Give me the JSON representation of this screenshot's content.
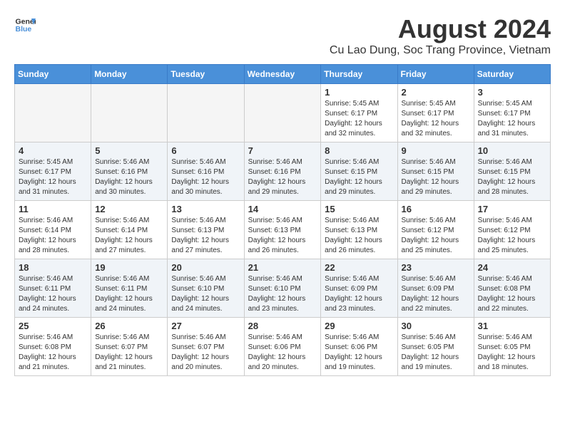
{
  "logo": {
    "line1": "General",
    "line2": "Blue"
  },
  "title": "August 2024",
  "subtitle": "Cu Lao Dung, Soc Trang Province, Vietnam",
  "days_of_week": [
    "Sunday",
    "Monday",
    "Tuesday",
    "Wednesday",
    "Thursday",
    "Friday",
    "Saturday"
  ],
  "weeks": [
    [
      {
        "day": "",
        "details": ""
      },
      {
        "day": "",
        "details": ""
      },
      {
        "day": "",
        "details": ""
      },
      {
        "day": "",
        "details": ""
      },
      {
        "day": "1",
        "details": "Sunrise: 5:45 AM\nSunset: 6:17 PM\nDaylight: 12 hours\nand 32 minutes."
      },
      {
        "day": "2",
        "details": "Sunrise: 5:45 AM\nSunset: 6:17 PM\nDaylight: 12 hours\nand 32 minutes."
      },
      {
        "day": "3",
        "details": "Sunrise: 5:45 AM\nSunset: 6:17 PM\nDaylight: 12 hours\nand 31 minutes."
      }
    ],
    [
      {
        "day": "4",
        "details": "Sunrise: 5:45 AM\nSunset: 6:17 PM\nDaylight: 12 hours\nand 31 minutes."
      },
      {
        "day": "5",
        "details": "Sunrise: 5:46 AM\nSunset: 6:16 PM\nDaylight: 12 hours\nand 30 minutes."
      },
      {
        "day": "6",
        "details": "Sunrise: 5:46 AM\nSunset: 6:16 PM\nDaylight: 12 hours\nand 30 minutes."
      },
      {
        "day": "7",
        "details": "Sunrise: 5:46 AM\nSunset: 6:16 PM\nDaylight: 12 hours\nand 29 minutes."
      },
      {
        "day": "8",
        "details": "Sunrise: 5:46 AM\nSunset: 6:15 PM\nDaylight: 12 hours\nand 29 minutes."
      },
      {
        "day": "9",
        "details": "Sunrise: 5:46 AM\nSunset: 6:15 PM\nDaylight: 12 hours\nand 29 minutes."
      },
      {
        "day": "10",
        "details": "Sunrise: 5:46 AM\nSunset: 6:15 PM\nDaylight: 12 hours\nand 28 minutes."
      }
    ],
    [
      {
        "day": "11",
        "details": "Sunrise: 5:46 AM\nSunset: 6:14 PM\nDaylight: 12 hours\nand 28 minutes."
      },
      {
        "day": "12",
        "details": "Sunrise: 5:46 AM\nSunset: 6:14 PM\nDaylight: 12 hours\nand 27 minutes."
      },
      {
        "day": "13",
        "details": "Sunrise: 5:46 AM\nSunset: 6:13 PM\nDaylight: 12 hours\nand 27 minutes."
      },
      {
        "day": "14",
        "details": "Sunrise: 5:46 AM\nSunset: 6:13 PM\nDaylight: 12 hours\nand 26 minutes."
      },
      {
        "day": "15",
        "details": "Sunrise: 5:46 AM\nSunset: 6:13 PM\nDaylight: 12 hours\nand 26 minutes."
      },
      {
        "day": "16",
        "details": "Sunrise: 5:46 AM\nSunset: 6:12 PM\nDaylight: 12 hours\nand 25 minutes."
      },
      {
        "day": "17",
        "details": "Sunrise: 5:46 AM\nSunset: 6:12 PM\nDaylight: 12 hours\nand 25 minutes."
      }
    ],
    [
      {
        "day": "18",
        "details": "Sunrise: 5:46 AM\nSunset: 6:11 PM\nDaylight: 12 hours\nand 24 minutes."
      },
      {
        "day": "19",
        "details": "Sunrise: 5:46 AM\nSunset: 6:11 PM\nDaylight: 12 hours\nand 24 minutes."
      },
      {
        "day": "20",
        "details": "Sunrise: 5:46 AM\nSunset: 6:10 PM\nDaylight: 12 hours\nand 24 minutes."
      },
      {
        "day": "21",
        "details": "Sunrise: 5:46 AM\nSunset: 6:10 PM\nDaylight: 12 hours\nand 23 minutes."
      },
      {
        "day": "22",
        "details": "Sunrise: 5:46 AM\nSunset: 6:09 PM\nDaylight: 12 hours\nand 23 minutes."
      },
      {
        "day": "23",
        "details": "Sunrise: 5:46 AM\nSunset: 6:09 PM\nDaylight: 12 hours\nand 22 minutes."
      },
      {
        "day": "24",
        "details": "Sunrise: 5:46 AM\nSunset: 6:08 PM\nDaylight: 12 hours\nand 22 minutes."
      }
    ],
    [
      {
        "day": "25",
        "details": "Sunrise: 5:46 AM\nSunset: 6:08 PM\nDaylight: 12 hours\nand 21 minutes."
      },
      {
        "day": "26",
        "details": "Sunrise: 5:46 AM\nSunset: 6:07 PM\nDaylight: 12 hours\nand 21 minutes."
      },
      {
        "day": "27",
        "details": "Sunrise: 5:46 AM\nSunset: 6:07 PM\nDaylight: 12 hours\nand 20 minutes."
      },
      {
        "day": "28",
        "details": "Sunrise: 5:46 AM\nSunset: 6:06 PM\nDaylight: 12 hours\nand 20 minutes."
      },
      {
        "day": "29",
        "details": "Sunrise: 5:46 AM\nSunset: 6:06 PM\nDaylight: 12 hours\nand 19 minutes."
      },
      {
        "day": "30",
        "details": "Sunrise: 5:46 AM\nSunset: 6:05 PM\nDaylight: 12 hours\nand 19 minutes."
      },
      {
        "day": "31",
        "details": "Sunrise: 5:46 AM\nSunset: 6:05 PM\nDaylight: 12 hours\nand 18 minutes."
      }
    ]
  ]
}
